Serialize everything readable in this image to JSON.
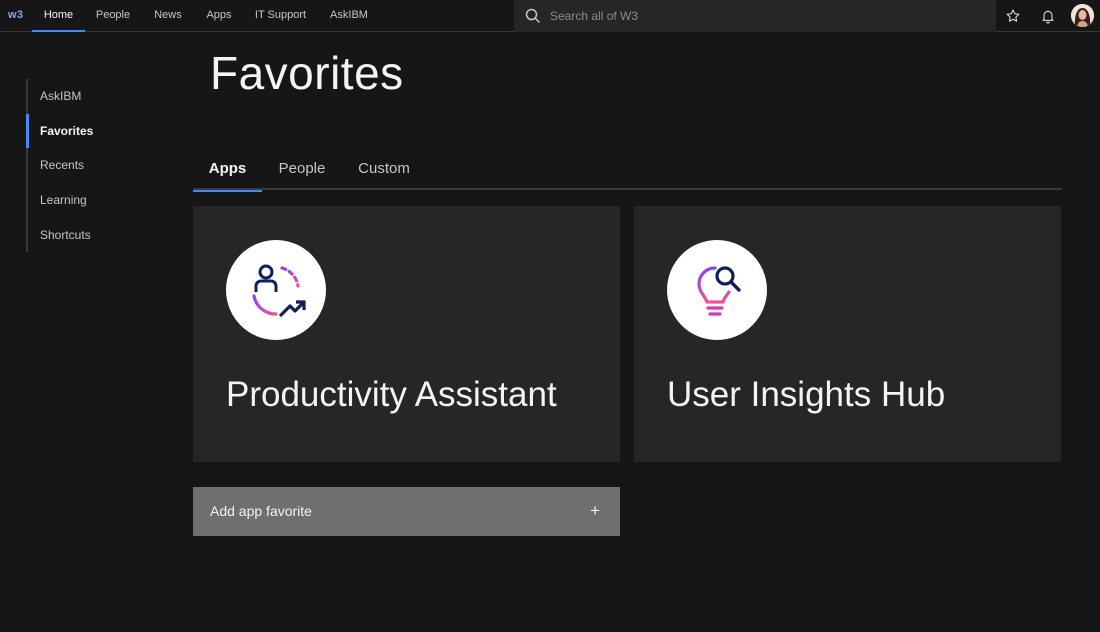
{
  "header": {
    "logo": "w3",
    "nav": [
      {
        "label": "Home",
        "active": true
      },
      {
        "label": "People",
        "active": false
      },
      {
        "label": "News",
        "active": false
      },
      {
        "label": "Apps",
        "active": false
      },
      {
        "label": "IT Support",
        "active": false
      },
      {
        "label": "AskIBM",
        "active": false
      }
    ],
    "search": {
      "placeholder": "Search all of W3",
      "value": ""
    },
    "icons": [
      "search-icon",
      "star-icon",
      "bell-icon",
      "avatar"
    ]
  },
  "sidebar": {
    "items": [
      {
        "label": "AskIBM",
        "active": false
      },
      {
        "label": "Favorites",
        "active": true
      },
      {
        "label": "Recents",
        "active": false
      },
      {
        "label": "Learning",
        "active": false
      },
      {
        "label": "Shortcuts",
        "active": false
      }
    ]
  },
  "main": {
    "title": "Favorites",
    "tabs": [
      {
        "label": "Apps",
        "active": true
      },
      {
        "label": "People",
        "active": false
      },
      {
        "label": "Custom",
        "active": false
      }
    ],
    "cards": [
      {
        "title": "Productivity Assistant",
        "icon": "person-growth-icon"
      },
      {
        "title": "User Insights Hub",
        "icon": "lightbulb-search-icon"
      }
    ],
    "add_button": {
      "label": "Add app favorite",
      "icon": "plus-icon",
      "glyph": "+"
    }
  },
  "colors": {
    "background": "#161616",
    "surface": "#262626",
    "accent": "#4589ff",
    "logo": "#78a9ff",
    "add_button": "#6f6f6f",
    "icon_navy": "#0f1e5c",
    "icon_magenta": "#d23bb8",
    "icon_purple": "#8a3ffc"
  }
}
